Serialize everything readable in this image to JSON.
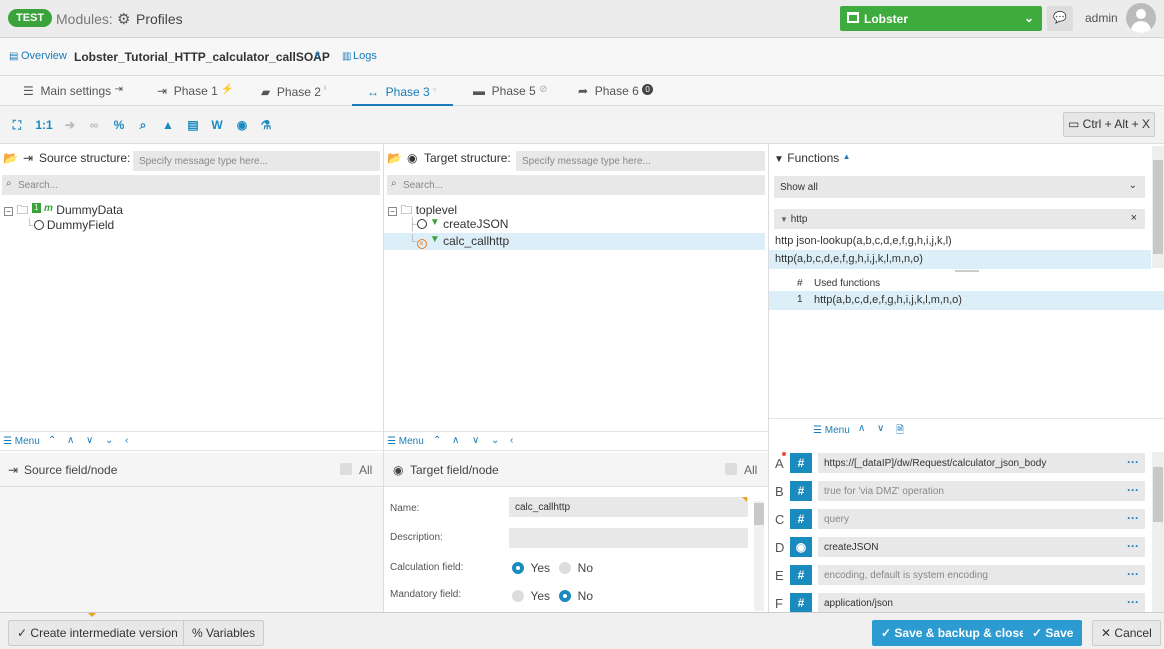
{
  "topbar": {
    "badge": "TEST",
    "modules_label": "Modules:",
    "profiles_label": "Profiles",
    "environment": "Lobster",
    "user": "admin"
  },
  "breadcrumb": {
    "overview": "Overview",
    "profile_name": "Lobster_Tutorial_HTTP_calculator_callSOAP",
    "logs": "Logs"
  },
  "tabs": [
    {
      "label": "Main settings"
    },
    {
      "label": "Phase 1"
    },
    {
      "label": "Phase 2"
    },
    {
      "label": "Phase 3"
    },
    {
      "label": "Phase 5"
    },
    {
      "label": "Phase 6"
    }
  ],
  "toolbar": {
    "one_to_one": "1:1",
    "shortcut": "Ctrl + Alt + X"
  },
  "source": {
    "title": "Source structure:",
    "type_placeholder": "Specify message type here...",
    "search_placeholder": "Search...",
    "tree": [
      {
        "label": "DummyData",
        "badge": "1"
      },
      {
        "label": "DummyField"
      }
    ],
    "menu_label": "Menu",
    "sub_title": "Source field/node",
    "all_label": "All"
  },
  "target": {
    "title": "Target structure:",
    "type_placeholder": "Specify message type here...",
    "search_placeholder": "Search...",
    "tree": [
      {
        "label": "toplevel"
      },
      {
        "label": "createJSON"
      },
      {
        "label": "calc_callhttp"
      }
    ],
    "menu_label": "Menu",
    "sub_title": "Target field/node",
    "all_label": "All",
    "form": {
      "name_label": "Name:",
      "name_value": "calc_callhttp",
      "description_label": "Description:",
      "description_value": "",
      "calc_label": "Calculation field:",
      "mandatory_label": "Mandatory field:",
      "yes": "Yes",
      "no": "No"
    }
  },
  "functions": {
    "title": "Functions",
    "filter_value": "Show all",
    "search_value": "http",
    "results": [
      "http json-lookup(a,b,c,d,e,f,g,h,i,j,k,l)",
      "http(a,b,c,d,e,f,g,h,i,j,k,l,m,n,o)"
    ],
    "used_header_num": "#",
    "used_header_label": "Used functions",
    "used": [
      {
        "num": "1",
        "label": "http(a,b,c,d,e,f,g,h,i,j,k,l,m,n,o)"
      }
    ],
    "menu_label": "Menu",
    "params": [
      {
        "letter": "A",
        "value": "https://[_dataIP]/dw/Request/calculator_json_body",
        "placeholder": false,
        "kind": "#"
      },
      {
        "letter": "B",
        "value": "true for 'via DMZ' operation",
        "placeholder": true,
        "kind": "#"
      },
      {
        "letter": "C",
        "value": "query",
        "placeholder": true,
        "kind": "#"
      },
      {
        "letter": "D",
        "value": "createJSON",
        "placeholder": false,
        "kind": "target"
      },
      {
        "letter": "E",
        "value": "encoding, default is system encoding",
        "placeholder": true,
        "kind": "#"
      },
      {
        "letter": "F",
        "value": "application/json",
        "placeholder": false,
        "kind": "#"
      }
    ]
  },
  "bottom": {
    "create_version": "Create intermediate version",
    "variables": "Variables",
    "save_backup_close": "Save & backup & close",
    "save": "Save",
    "cancel": "Cancel"
  },
  "colors": {
    "accent": "#1a8bbf",
    "env_green": "#3dab3d",
    "badge_green": "#3aa23a"
  }
}
